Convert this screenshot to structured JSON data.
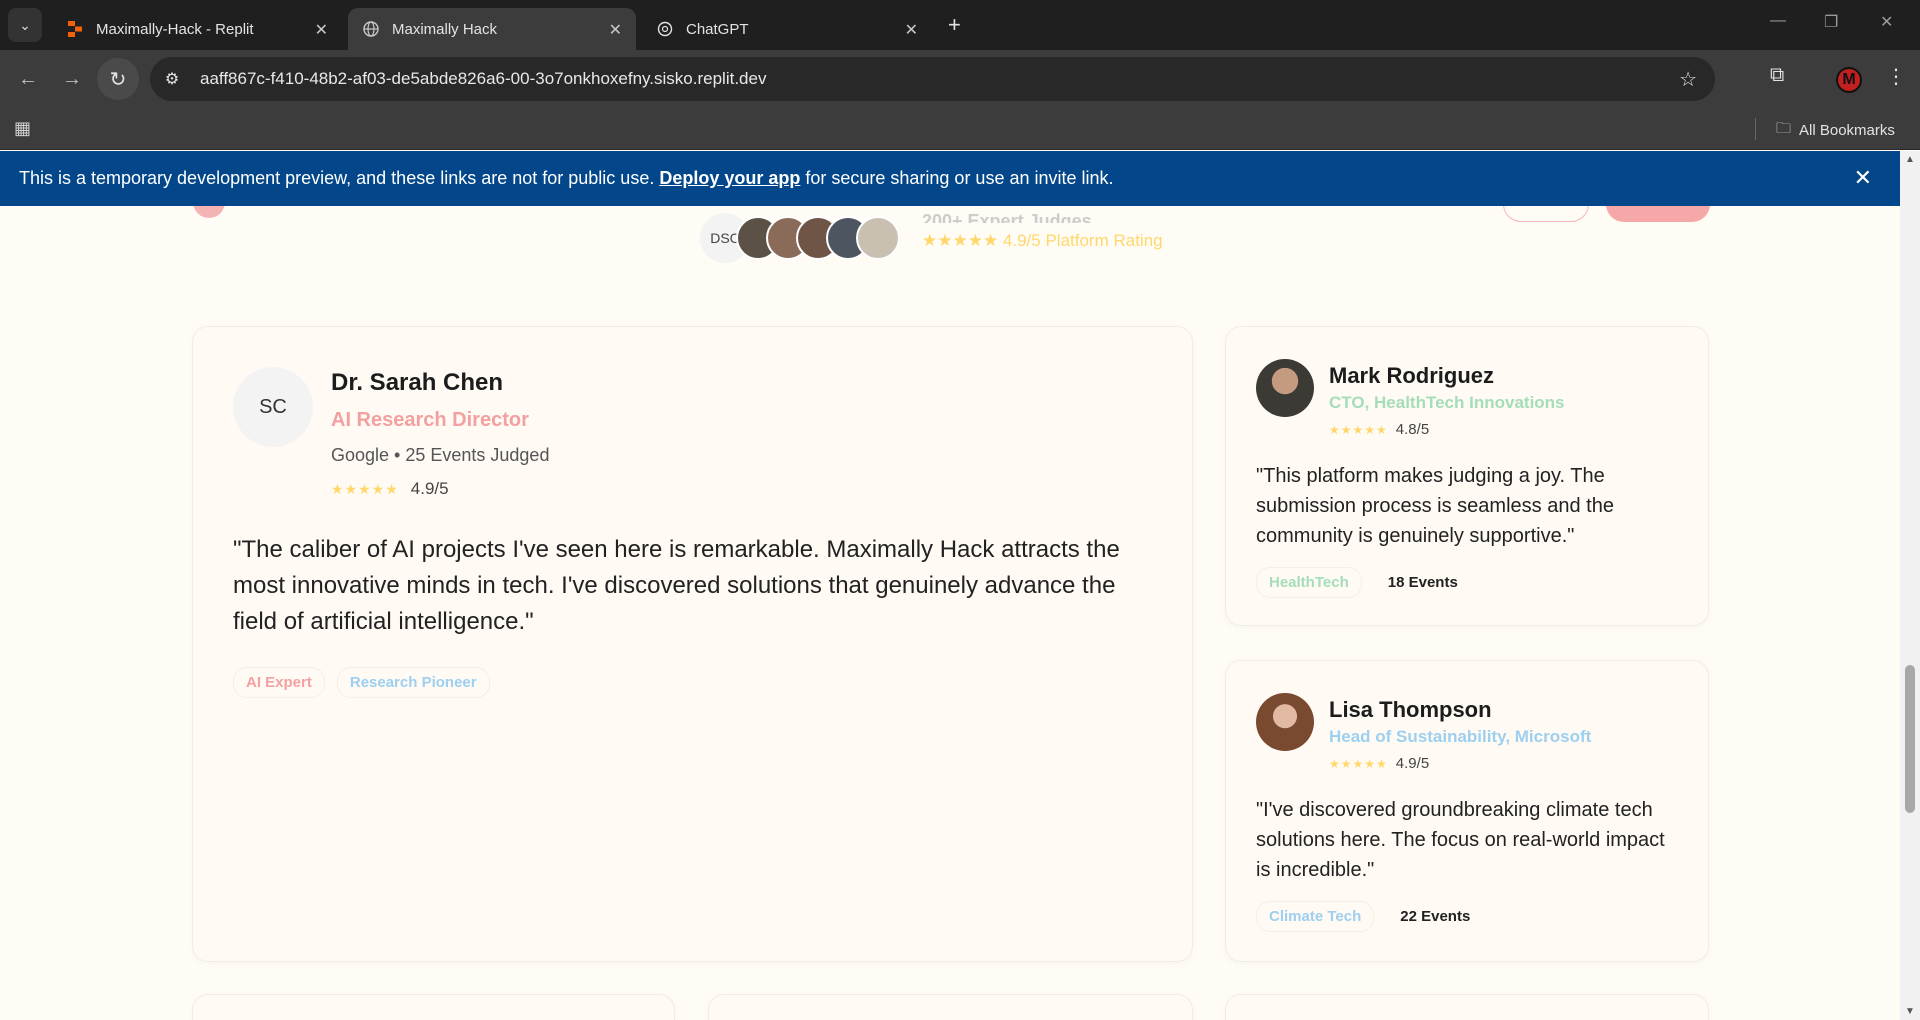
{
  "browser": {
    "tabs": [
      {
        "label": "Maximally-Hack - Replit"
      },
      {
        "label": "Maximally Hack"
      },
      {
        "label": "ChatGPT"
      }
    ],
    "url": "aaff867c-f410-48b2-af03-de5abde826a6-00-3o7onkhoxefny.sisko.replit.dev",
    "bookmarks_label": "All Bookmarks",
    "profile_initial": "M"
  },
  "banner": {
    "text_before": "This is a temporary development preview, and these links are not for public use.",
    "link": "Deploy your app",
    "text_after": "for secure sharing or use an invite link."
  },
  "strip": {
    "avatar_initials": "DSC",
    "heading": "200+ Expert Judges",
    "rating": "★★★★★ 4.9/5 Platform Rating"
  },
  "featured": {
    "initials": "SC",
    "name": "Dr. Sarah Chen",
    "role": "AI Research Director",
    "meta": "Google • 25 Events Judged",
    "stars": "★★★★★",
    "rating": "4.9/5",
    "quote": "\"The caliber of AI projects I've seen here is remarkable. Maximally Hack attracts the most innovative minds in tech. I've discovered solutions that genuinely advance the field of artificial intelligence.\"",
    "tags": [
      "AI Expert",
      "Research Pioneer"
    ]
  },
  "testimonials": [
    {
      "name": "Mark Rodriguez",
      "role": "CTO, HealthTech Innovations",
      "stars": "★★★★★",
      "rating": "4.8/5",
      "quote": "\"This platform makes judging a joy. The submission process is seamless and the community is genuinely supportive.\"",
      "tag": "HealthTech",
      "events": "18 Events"
    },
    {
      "name": "Lisa Thompson",
      "role": "Head of Sustainability, Microsoft",
      "stars": "★★★★★",
      "rating": "4.9/5",
      "quote": "\"I've discovered groundbreaking climate tech solutions here. The focus on real-world impact is incredible.\"",
      "tag": "Climate Tech",
      "events": "22 Events"
    }
  ],
  "colors": {
    "banner": "#03478a",
    "accent_pink": "#f3a0a0",
    "accent_green": "#a4ddb8",
    "accent_blue": "#9ccff0",
    "star": "#ffd76a",
    "page_bg": "#fffcf6"
  }
}
